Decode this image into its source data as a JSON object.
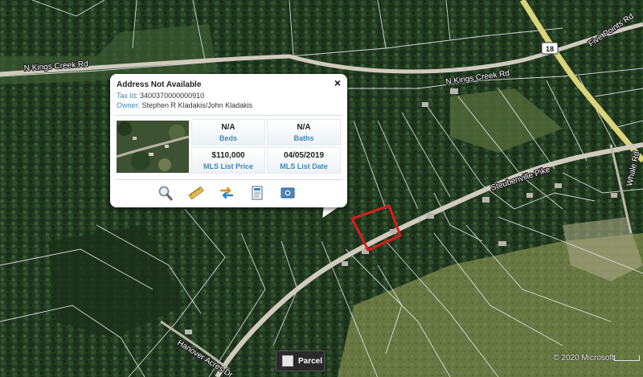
{
  "map": {
    "roads": [
      {
        "name": "N Kings Creek Rd"
      },
      {
        "name": "N Kings Creek Rd"
      },
      {
        "name": "Five Points Rd"
      },
      {
        "name": "Steubenville Pike"
      },
      {
        "name": "Hanover Acres Dr"
      },
      {
        "name": "Whale Rd"
      }
    ],
    "route_shield": "18",
    "copyright": "© 2020 Microsoft",
    "colors": {
      "forest": "#22381f",
      "field": "#6d7c45",
      "road": "#c8c4b2",
      "parcel_line": "#eef2f4",
      "selected_parcel": "#e01b1b"
    }
  },
  "popup": {
    "title": "Address Not Available",
    "close_icon": "×",
    "tax_id_label": "Tax Id:",
    "tax_id_value": "3400370000000910",
    "owner_label": "Owner:",
    "owner_value": "Stephen R Kladakis/John Kladakis",
    "stats": [
      {
        "value": "N/A",
        "label": "Beds"
      },
      {
        "value": "N/A",
        "label": "Baths"
      },
      {
        "value": "$110,000",
        "label": "MLS List Price"
      },
      {
        "value": "04/05/2019",
        "label": "MLS List Date"
      }
    ],
    "tools": [
      "zoom-icon",
      "ruler-icon",
      "swap-icon",
      "report-icon",
      "photo-icon"
    ]
  },
  "parcel_button": {
    "label": "Parcel"
  }
}
